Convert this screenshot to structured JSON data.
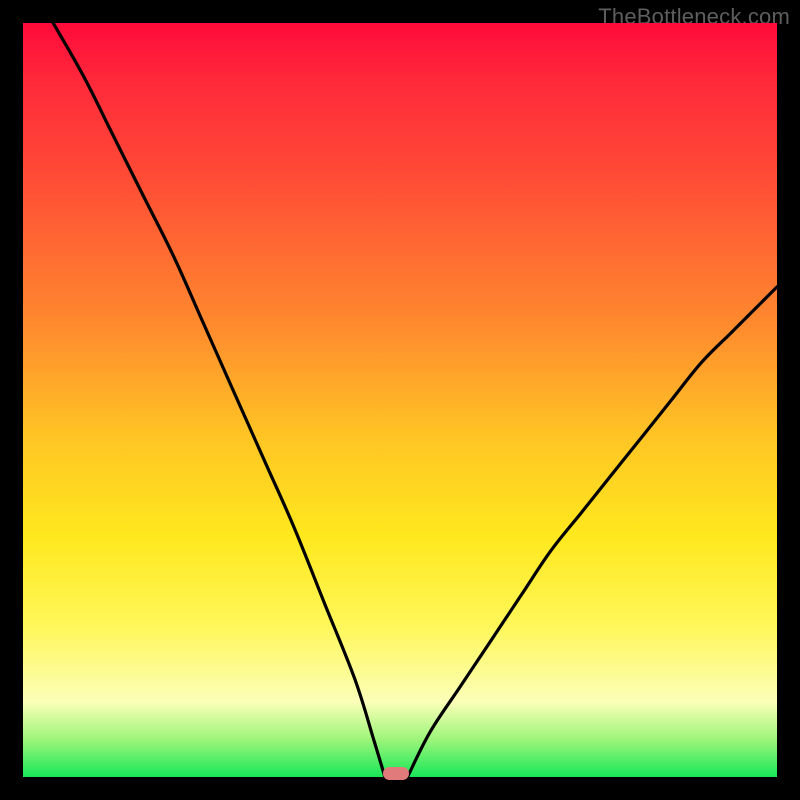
{
  "watermark": "TheBottleneck.com",
  "chart_data": {
    "type": "line",
    "title": "",
    "xlabel": "",
    "ylabel": "",
    "xlim": [
      0,
      100
    ],
    "ylim": [
      0,
      100
    ],
    "grid": false,
    "legend": false,
    "annotations": [],
    "left_curve": {
      "x": [
        4,
        8,
        12,
        16,
        20,
        24,
        28,
        32,
        36,
        40,
        44,
        46.5,
        48
      ],
      "y": [
        100,
        93,
        85,
        77,
        69,
        60,
        51,
        42,
        33,
        23,
        13,
        5,
        0
      ]
    },
    "right_curve": {
      "x": [
        51,
        54,
        58,
        62,
        66,
        70,
        74,
        78,
        82,
        86,
        90,
        94,
        98,
        100
      ],
      "y": [
        0,
        6,
        12,
        18,
        24,
        30,
        35,
        40,
        45,
        50,
        55,
        59,
        63,
        65
      ]
    },
    "marker": {
      "x": 49.5,
      "y": 0.5,
      "width_pct": 3.5,
      "height_pct": 1.7
    }
  },
  "colors": {
    "curve": "#000000",
    "marker": "#e17a7a",
    "background_top": "#ff0a3a",
    "background_bottom": "#18e858",
    "frame": "#000000"
  }
}
